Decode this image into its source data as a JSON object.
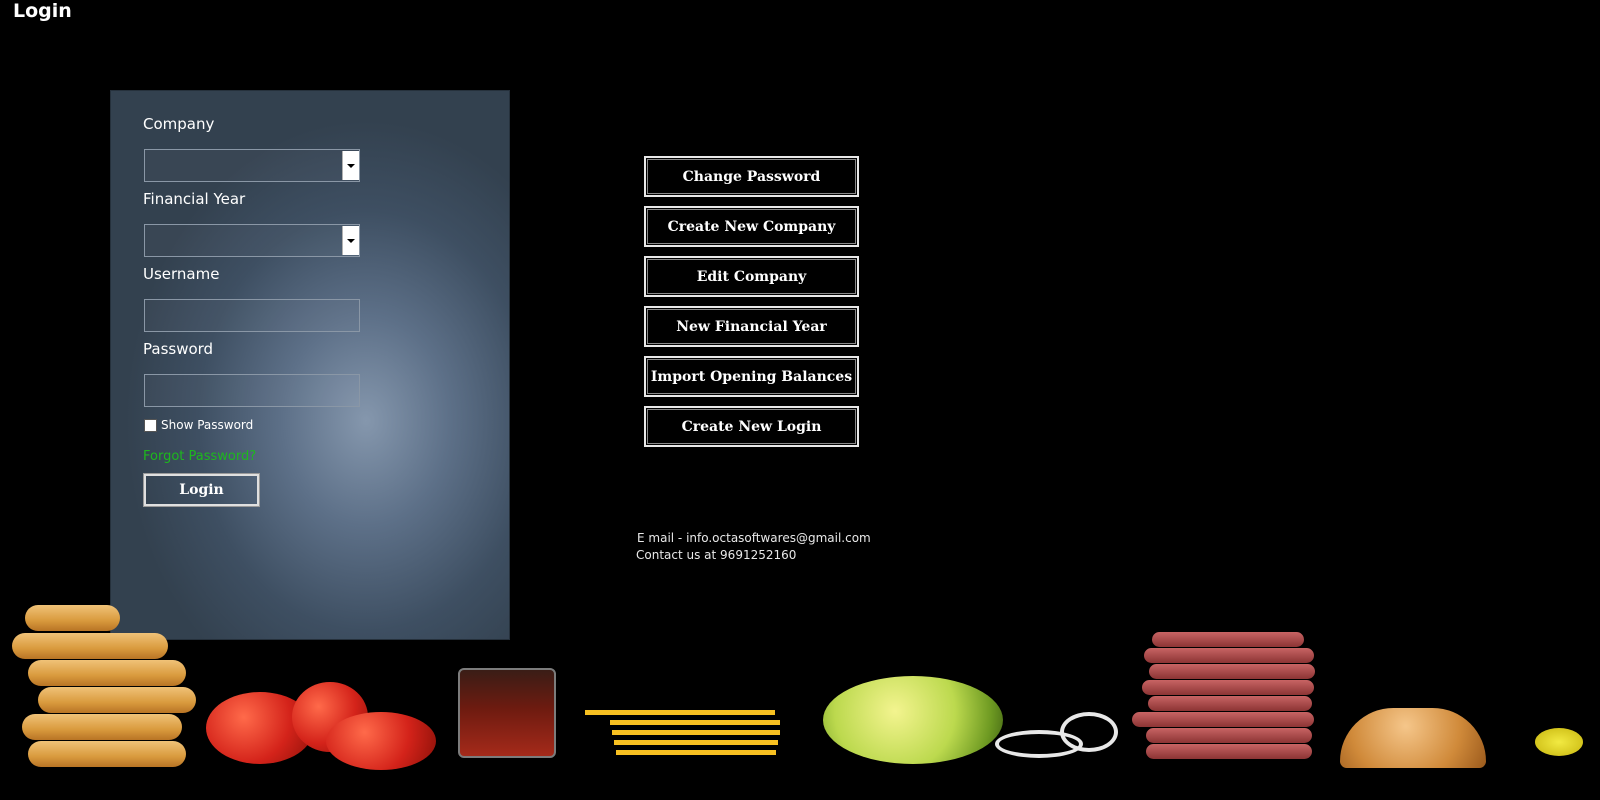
{
  "window": {
    "title": "Login"
  },
  "form": {
    "company_label": "Company",
    "company_value": "",
    "financial_year_label": "Financial Year",
    "financial_year_value": "",
    "username_label": "Username",
    "username_value": "",
    "password_label": "Password",
    "password_value": "",
    "show_password_label": "Show Password",
    "show_password_checked": false,
    "forgot_password_label": "Forgot Password?",
    "login_label": "Login"
  },
  "actions": [
    {
      "label": "Change Password"
    },
    {
      "label": "Create New Company"
    },
    {
      "label": "Edit Company"
    },
    {
      "label": "New Financial Year"
    },
    {
      "label": "Import Opening Balances"
    },
    {
      "label": "Create New Login"
    }
  ],
  "contact": {
    "email_line": "E mail - info.octasoftwares@gmail.com",
    "phone_line": "Contact us at 9691252160"
  },
  "colors": {
    "background": "#000000",
    "forgot_link": "#1db81d",
    "panel": "#4a5d72"
  }
}
